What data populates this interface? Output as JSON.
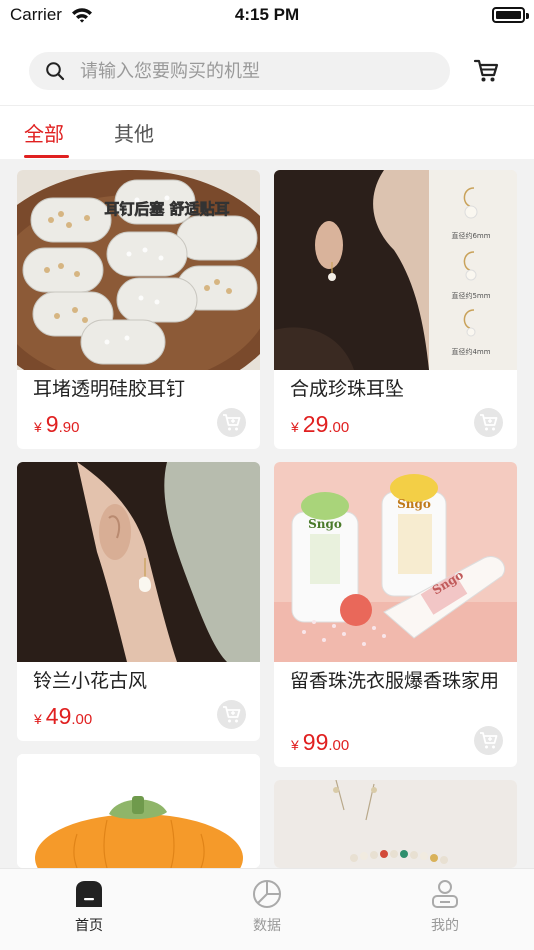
{
  "status_bar": {
    "carrier": "Carrier",
    "time": "4:15 PM"
  },
  "search": {
    "placeholder": "请输入您要购买的机型"
  },
  "tabs": [
    {
      "label": "全部",
      "active": true
    },
    {
      "label": "其他",
      "active": false
    }
  ],
  "products": [
    {
      "title": "耳堵透明硅胶耳钉",
      "currency": "¥",
      "price_int": "9",
      "price_dec": ".90",
      "image_text": "耳钉后塞 舒适贴耳"
    },
    {
      "title": "合成珍珠耳坠",
      "currency": "¥",
      "price_int": "29",
      "price_dec": ".00",
      "image_text": [
        "直径约6mm",
        "直径约5mm",
        "直径约4mm"
      ]
    },
    {
      "title": "铃兰小花古风",
      "currency": "¥",
      "price_int": "49",
      "price_dec": ".00"
    },
    {
      "title": "留香珠洗衣服爆香珠家用",
      "currency": "¥",
      "price_int": "99",
      "price_dec": ".00",
      "image_text": [
        "Sngo",
        "Sngo",
        "Sngo"
      ]
    },
    {
      "title": ""
    },
    {
      "title": ""
    }
  ],
  "tabbar": [
    {
      "label": "首页",
      "icon": "home-icon",
      "active": true
    },
    {
      "label": "数据",
      "icon": "chart-icon",
      "active": false
    },
    {
      "label": "我的",
      "icon": "profile-icon",
      "active": false
    }
  ],
  "colors": {
    "accent": "#e02020",
    "background": "#f2f2f2"
  }
}
